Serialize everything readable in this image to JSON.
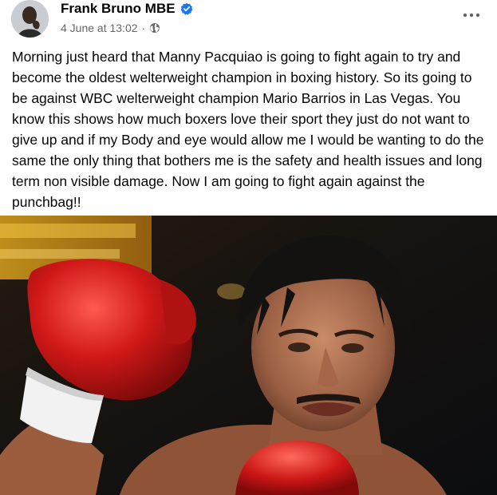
{
  "post": {
    "author": "Frank Bruno MBE",
    "timestamp": "4 June at 13:02",
    "separator": "·",
    "verified_icon": "verified-badge-icon",
    "privacy_icon": "globe-icon",
    "more_icon": "more-horizontal-icon",
    "text": "Morning just heard that Manny Pacquiao is going to fight again to try and become the oldest welterweight champion in boxing history. So its going to be against WBC welterweight champion Mario Barrios in Las Vegas. You know this shows how much boxers love their sport they just do not want to give up and if my Body and eye would allow me I would be wanting to do the same the only thing that bothers me is the safety and health issues and long term non visible damage. Now I am going to fight again against the punchbag!!"
  },
  "colors": {
    "verified": "#1877f2",
    "meta_text": "#65676b",
    "glove_red": "#d01818"
  }
}
